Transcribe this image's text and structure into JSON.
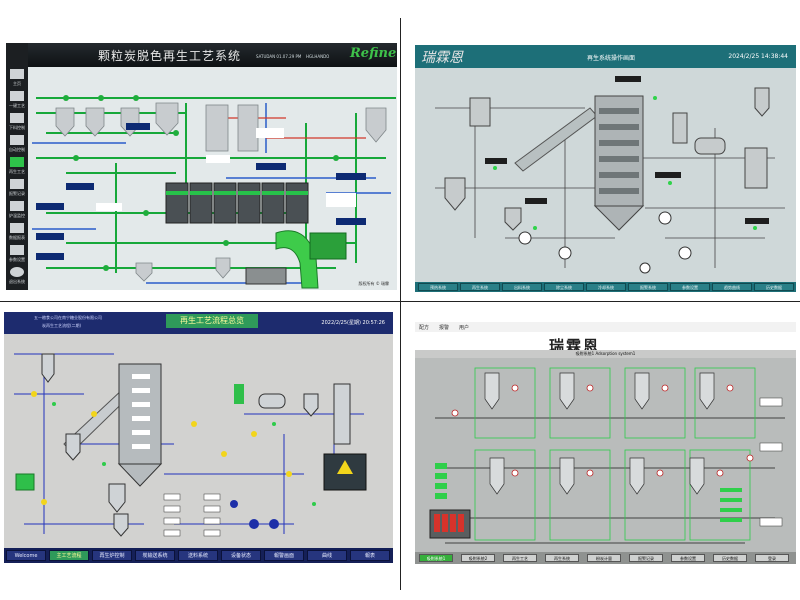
{
  "panel1": {
    "title": "颗粒炭脱色再生工艺系统",
    "logo": "Refine",
    "header_info": [
      "SATUDAN 01.07.29 PM",
      "HGLHANDO"
    ],
    "sidebar": [
      "主页",
      "一键工艺",
      "下料控制",
      "自动控制",
      "再生工艺",
      "报警记录",
      "炉温监控",
      "数据报表",
      "参数设置",
      "退出系统"
    ],
    "footer": "版权所有 © 瑞霖"
  },
  "panel2": {
    "logo": "瑞霖恩",
    "title": "再生系统操作画面",
    "time": "2024/2/25 14:38:44",
    "nav": [
      "预热系统",
      "再生系统",
      "出料系统",
      "除尘系统",
      "冷却系统",
      "报警系统",
      "参数设置",
      "趋势曲线",
      "历史数据"
    ]
  },
  "panel3": {
    "header_line1": "五一粮食公司在南宁糖业股份有限公司",
    "header_line2": "炭再生工艺流程(二期)",
    "title": "再生工艺流程总览",
    "time": "2022/2/25(星期) 20:57:26",
    "nav": [
      "Welcome",
      "主工艺流程",
      "再生炉控制",
      "炭输送系统",
      "送料系统",
      "设备状态",
      "報警画面",
      "曲线",
      "報表"
    ]
  },
  "panel4": {
    "menubar": [
      "配方",
      "报警",
      "用户"
    ],
    "logo": "瑞霖恩",
    "title": "吸附系统1 Adsorption system1",
    "nav": [
      "吸附系统1",
      "吸附系统2",
      "再生工艺",
      "再生系统",
      "粉炭计量",
      "报警记录",
      "参数设置",
      "历史数据",
      "登录"
    ]
  }
}
